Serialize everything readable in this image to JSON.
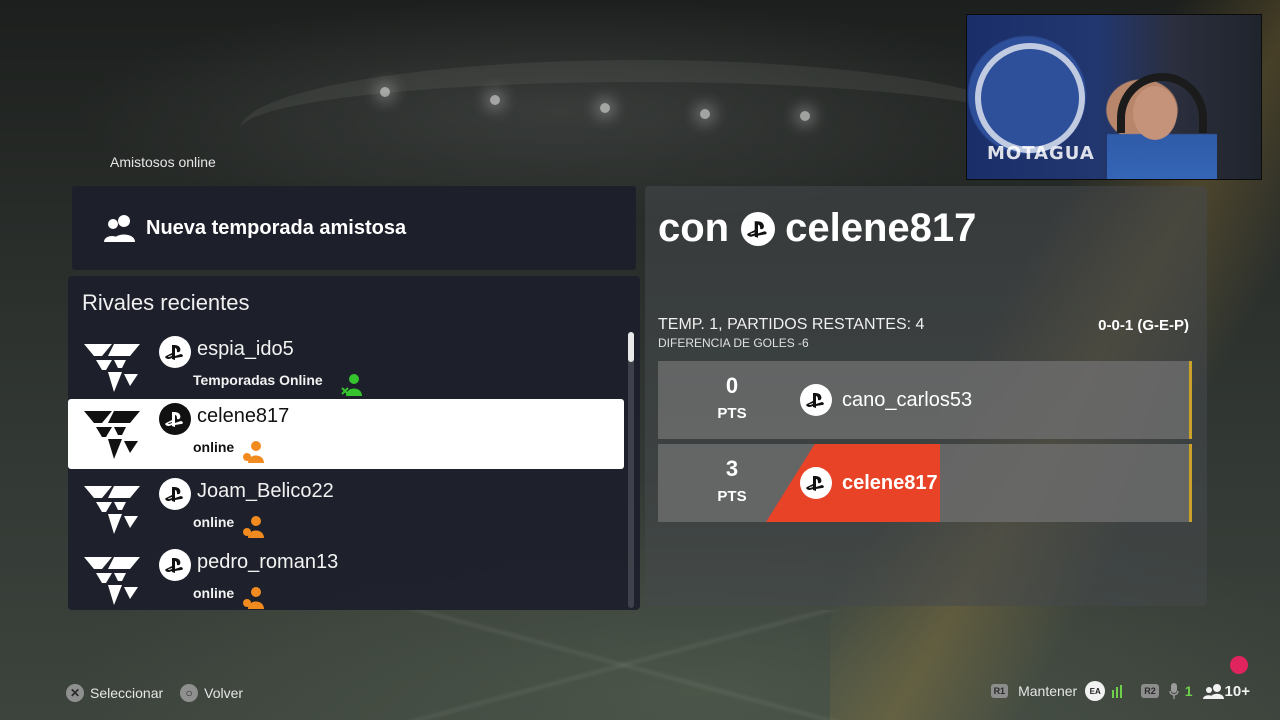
{
  "breadcrumb": "Amistosos online",
  "new_season": {
    "label": "Nueva temporada amistosa",
    "icon": "people-icon"
  },
  "rivals": {
    "title": "Rivales recientes",
    "items": [
      {
        "name": "espia_ido5",
        "status": "Temporadas Online",
        "status_color": "#35c32e",
        "selected": false
      },
      {
        "name": "celene817",
        "status": "online",
        "status_color": "#f28b1f",
        "selected": true
      },
      {
        "name": "Joam_Belico22",
        "status": "online",
        "status_color": "#f28b1f",
        "selected": false
      },
      {
        "name": "pedro_roman13",
        "status": "online",
        "status_color": "#f28b1f",
        "selected": false
      }
    ]
  },
  "opponent": {
    "prefix": "con",
    "name": "celene817",
    "season_info": "TEMP. 1, PARTIDOS RESTANTES: 4",
    "goal_diff": "DIFERENCIA DE GOLES -6",
    "record": "0-0-1 (G-E-P)",
    "standings": [
      {
        "points": "0",
        "pts_label": "PTS",
        "player": "cano_carlos53",
        "highlight": false
      },
      {
        "points": "3",
        "pts_label": "PTS",
        "player": "celene817",
        "highlight": true
      }
    ]
  },
  "webcam": {
    "jersey_text": "MOTAGUA"
  },
  "footer": {
    "select_label": "Seleccionar",
    "back_label": "Volver",
    "hold_tag": "R1",
    "hold_label": "Mantener",
    "ea_label": "EA",
    "r2_tag": "R2",
    "mic_count": "1",
    "friends_count": "10+"
  },
  "colors": {
    "accent": "#e84227",
    "gold": "#c9a227",
    "panel": "#1c1e2a"
  }
}
